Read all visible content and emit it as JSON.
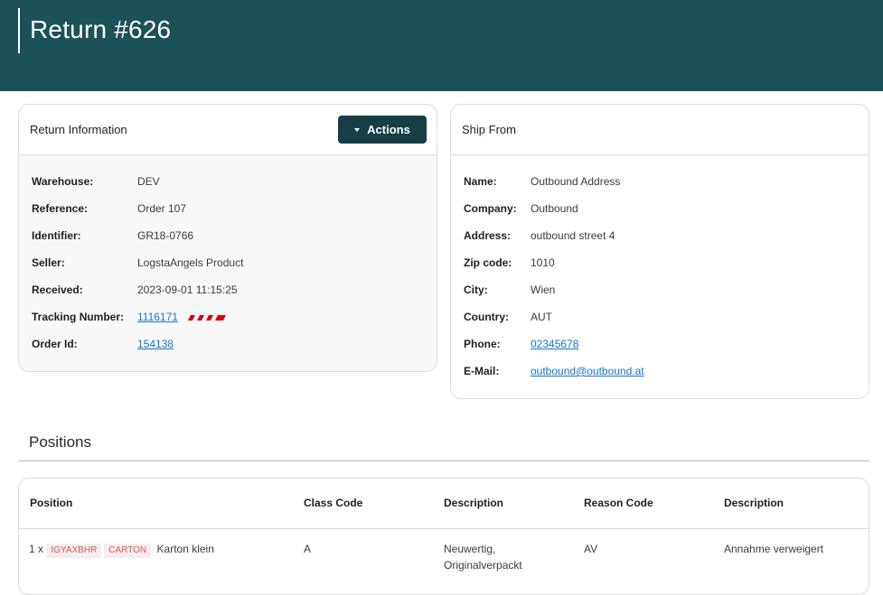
{
  "header": {
    "title": "Return #626"
  },
  "return_info": {
    "title": "Return Information",
    "actions_label": "Actions",
    "fields": {
      "warehouse": {
        "label": "Warehouse:",
        "value": "DEV"
      },
      "reference": {
        "label": "Reference:",
        "value": "Order 107"
      },
      "identifier": {
        "label": "Identifier:",
        "value": "GR18-0766"
      },
      "seller": {
        "label": "Seller:",
        "value": "LogstaAngels Product"
      },
      "received": {
        "label": "Received:",
        "value": "2023-09-01 11:15:25"
      },
      "tracking": {
        "label": "Tracking Number:",
        "value": "1116171",
        "carrier": "DHL"
      },
      "order_id": {
        "label": "Order Id:",
        "value": "154138"
      }
    }
  },
  "ship_from": {
    "title": "Ship From",
    "fields": {
      "name": {
        "label": "Name:",
        "value": "Outbound Address"
      },
      "company": {
        "label": "Company:",
        "value": "Outbound"
      },
      "address": {
        "label": "Address:",
        "value": "outbound street 4"
      },
      "zip": {
        "label": "Zip code:",
        "value": "1010"
      },
      "city": {
        "label": "City:",
        "value": "Wien"
      },
      "country": {
        "label": "Country:",
        "value": "AUT"
      },
      "phone": {
        "label": "Phone:",
        "value": "02345678"
      },
      "email": {
        "label": "E-Mail:",
        "value": "outbound@outbound.at"
      }
    }
  },
  "positions": {
    "title": "Positions",
    "columns": [
      "Position",
      "Class Code",
      "Description",
      "Reason Code",
      "Description"
    ],
    "rows": [
      {
        "qty": "1 x",
        "tags": [
          "IGYAXBHR",
          "CARTON"
        ],
        "product": "Karton klein",
        "class_code": "A",
        "description_line1": "Neuwertig,",
        "description_line2": "Originalverpackt",
        "reason_code": "AV",
        "reason_description": "Annahme verweigert"
      }
    ]
  },
  "colors": {
    "header_bg": "#1b5258",
    "button_bg": "#163f45",
    "link": "#1a73c9",
    "tag_text": "#d55a5a"
  }
}
